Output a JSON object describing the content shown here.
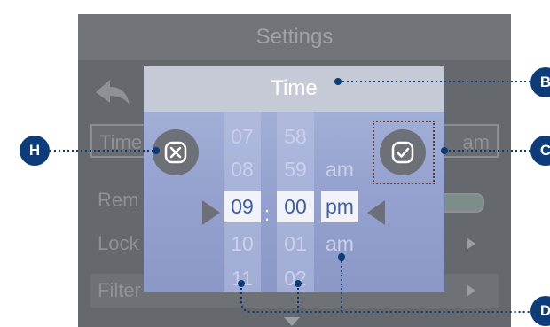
{
  "screen": {
    "header_title": "Settings",
    "rows": [
      {
        "label": "Time",
        "value": "am"
      },
      {
        "label": "Rem"
      },
      {
        "label": "Lock"
      },
      {
        "label": "Filter"
      }
    ]
  },
  "modal": {
    "title": "Time",
    "hours": [
      "07",
      "08",
      "09",
      "10",
      "11"
    ],
    "minutes": [
      "58",
      "59",
      "00",
      "01",
      "02"
    ],
    "ampm": [
      "am",
      "pm",
      "am"
    ],
    "separator": ":",
    "selected": {
      "hour": "09",
      "minute": "00",
      "period": "pm"
    }
  },
  "callouts": {
    "h": "H",
    "b": "B",
    "c": "C",
    "d": "D"
  },
  "colors": {
    "callout": "#0c3c7a",
    "modal_bg": "#95a2cf",
    "selected_text": "#3e5fa8",
    "screen_bg": "#65686c"
  },
  "icons": {
    "back": "back-arrow-icon",
    "cancel": "cancel-x-icon",
    "confirm": "checkmark-icon",
    "pointer_left": "triangle-right-icon",
    "pointer_right": "triangle-left-icon",
    "scroll_more": "chevron-down-icon"
  }
}
